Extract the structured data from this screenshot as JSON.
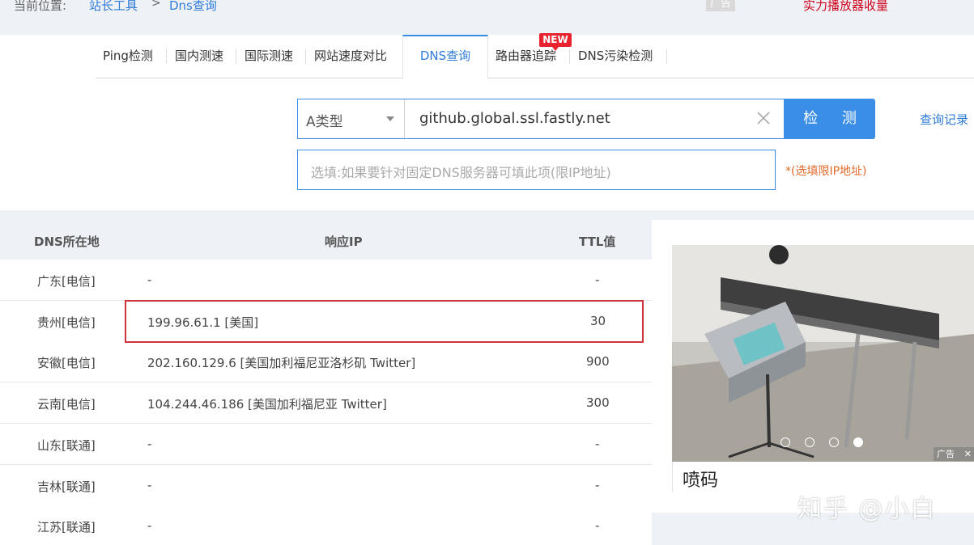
{
  "breadcrumb": {
    "label": "当前位置:",
    "home": "站长工具",
    "separator": ">",
    "current": "Dns查询"
  },
  "top_ad": {
    "tag": "广告",
    "text": "实力播放器收量"
  },
  "tabs": [
    {
      "label": "Ping检测"
    },
    {
      "label": "国内测速"
    },
    {
      "label": "国际测速"
    },
    {
      "label": "网站速度对比"
    },
    {
      "label": "DNS查询",
      "active": true
    },
    {
      "label": "路由器追踪"
    },
    {
      "label": "DNS污染检测",
      "badge": "NEW"
    }
  ],
  "query": {
    "type_value": "A类型",
    "domain_value": "github.global.ssl.fastly.net",
    "check_label": "检 测",
    "history_label": "查询记录",
    "dns_placeholder": "选填:如果要针对固定DNS服务器可填此项(限IP地址)",
    "dns_hint": "*(选填限IP地址)"
  },
  "table": {
    "headers": [
      "DNS所在地",
      "响应IP",
      "TTL值"
    ],
    "rows": [
      {
        "location": "广东[电信]",
        "ip": "-",
        "ttl": "-"
      },
      {
        "location": "贵州[电信]",
        "ip": "199.96.61.1 [美国]",
        "ttl": "30",
        "highlighted": true
      },
      {
        "location": "安徽[电信]",
        "ip": "202.160.129.6 [美国加利福尼亚洛杉矶 Twitter]",
        "ttl": "900"
      },
      {
        "location": "云南[电信]",
        "ip": "104.244.46.186 [美国加利福尼亚 Twitter]",
        "ttl": "300"
      },
      {
        "location": "山东[联通]",
        "ip": "-",
        "ttl": "-"
      },
      {
        "location": "吉林[联通]",
        "ip": "-",
        "ttl": "-"
      },
      {
        "location": "江苏[联通]",
        "ip": "-",
        "ttl": "-"
      }
    ]
  },
  "side_ad": {
    "caption": "喷码",
    "ad_label": "广告",
    "slides": 4,
    "active_slide": 4
  },
  "watermark": "知乎 @小白",
  "colors": {
    "accent": "#3a8ee6",
    "highlight": "#d0353e",
    "badge": "#e8222f",
    "hint": "#e36a2a"
  }
}
